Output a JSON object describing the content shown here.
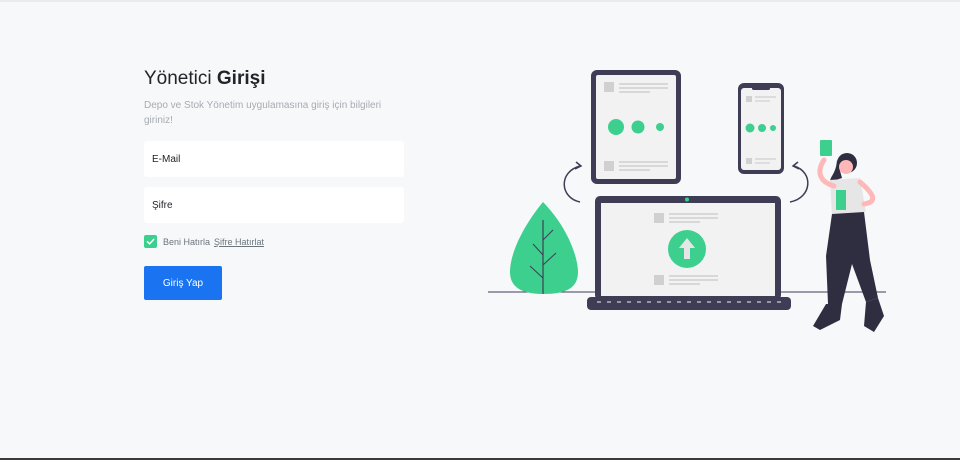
{
  "login": {
    "title_normal": "Yönetici",
    "title_bold": "Girişi",
    "subtitle": "Depo ve Stok Yönetim uygulamasına giriş için bilgileri giriniz!",
    "email_placeholder": "E-Mail",
    "password_placeholder": "Şifre",
    "remember_label": "Beni Hatırla",
    "forgot_link": "Şifre Hatırlat",
    "submit_label": "Giriş Yap",
    "remember_checked": true
  },
  "colors": {
    "accent_green": "#3ccf8e",
    "primary_blue": "#1a73f0",
    "background": "#f7f8fa"
  },
  "illustration": {
    "icons": [
      "tablet-icon",
      "phone-icon",
      "laptop-icon",
      "plant-icon",
      "person-icon",
      "upload-arrow-icon"
    ]
  }
}
